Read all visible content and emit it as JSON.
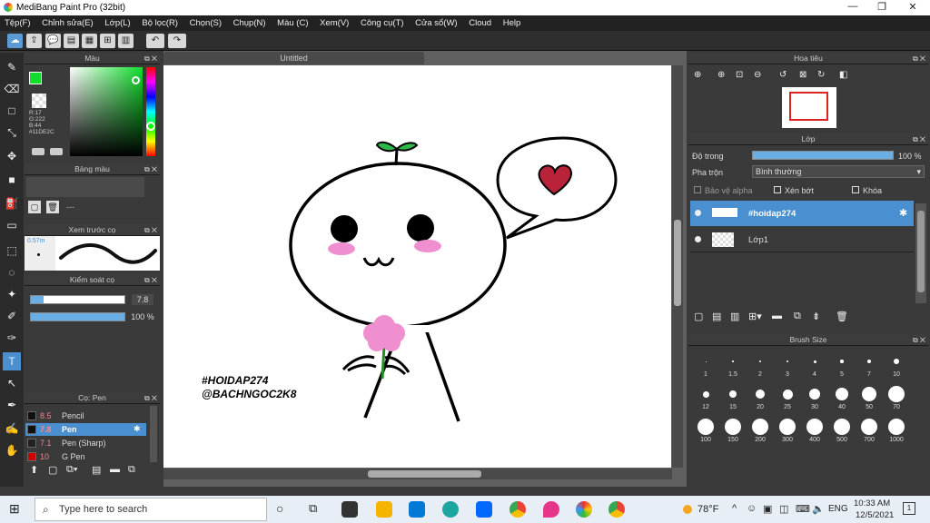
{
  "window": {
    "title": "MediBang Paint Pro (32bit)",
    "minimize": "—",
    "restore": "❐",
    "close": "✕"
  },
  "menu": [
    "Tệp(F)",
    "Chỉnh sửa(E)",
    "Lớp(L)",
    "Bộ lọc(R)",
    "Chọn(S)",
    "Chụp(N)",
    "Màu (C)",
    "Xem(V)",
    "Công cụ(T)",
    "Cửa sổ(W)",
    "Cloud",
    "Help"
  ],
  "document": {
    "tab": "Untitled",
    "watermark1": "#HOIDAP274",
    "watermark2": "@BACHNGOC2K8"
  },
  "color_panel": {
    "title": "Màu",
    "rgb": "R:17\nG:222\nB:44",
    "r": "R:17",
    "g": "G:222",
    "b": "B:44",
    "hex": "#11DE2C",
    "main_color": "#11DE2C"
  },
  "palette_panel": {
    "title": "Bảng màu",
    "label": "---"
  },
  "brush_preview": {
    "title": "Xem trước cọ",
    "size": "0.57m"
  },
  "brush_control": {
    "title": "Kiểm soát cọ",
    "size_value": "7.8",
    "opacity_value": "100 %"
  },
  "brush_list": {
    "title": "Cọ: Pen",
    "items": [
      {
        "size": "8.5",
        "name": "Pencil",
        "selected": false,
        "color": "#111111"
      },
      {
        "size": "7.8",
        "name": "Pen",
        "selected": true,
        "color": "#111111"
      },
      {
        "size": "7.1",
        "name": "Pen (Sharp)",
        "selected": false,
        "color": "#222222"
      },
      {
        "size": "10",
        "name": "G Pen",
        "selected": false,
        "color": "#cc0000"
      }
    ]
  },
  "navigator": {
    "title": "Hoa tiêu"
  },
  "layer_panel": {
    "title": "Lớp",
    "opacity_label": "Độ trong",
    "opacity_value": "100 %",
    "blend_label": "Pha trộn",
    "blend_value": "Bình thường",
    "protect_alpha": "Bảo vệ alpha",
    "clipping": "Xén bớt",
    "lock": "Khóa",
    "layers": [
      {
        "name": "#hoidap274",
        "selected": true
      },
      {
        "name": "Lớp1",
        "selected": false
      }
    ]
  },
  "brush_size": {
    "title": "Brush Size",
    "sizes": [
      "1",
      "1.5",
      "2",
      "3",
      "4",
      "5",
      "7",
      "10",
      "12",
      "15",
      "20",
      "25",
      "30",
      "40",
      "50",
      "70",
      "100",
      "150",
      "200",
      "300",
      "400",
      "500",
      "700",
      "1000"
    ]
  },
  "taskbar": {
    "search_placeholder": "Type here to search",
    "temperature": "78°F",
    "language": "ENG",
    "time": "10:33 AM",
    "date": "12/5/2021",
    "notifications": "1"
  }
}
